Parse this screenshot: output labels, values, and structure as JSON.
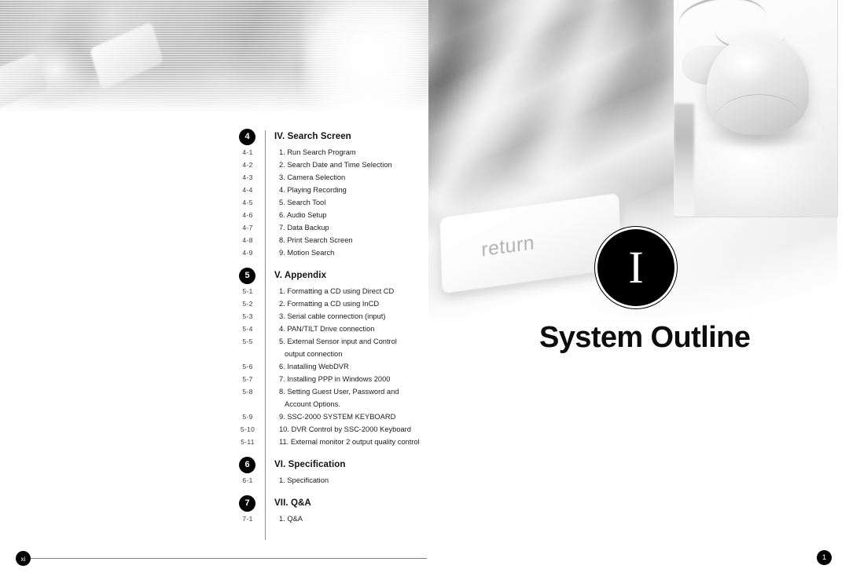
{
  "page": {
    "title": "System Outline",
    "roman_numeral": "I",
    "footer_left_page": "xi",
    "footer_right_page": "1"
  },
  "photos": [
    {
      "name": "keyboard-halftone-photo",
      "caption": ""
    },
    {
      "name": "return-key-photo",
      "caption": "return"
    },
    {
      "name": "computer-mouse-photo",
      "caption": ""
    }
  ],
  "toc": {
    "sections": [
      {
        "badge": "4",
        "title": "IV. Search Screen",
        "entries": [
          {
            "num": "4-1",
            "label": "1. Run Search Program"
          },
          {
            "num": "4-2",
            "label": "2. Search Date and Time Selection"
          },
          {
            "num": "4-3",
            "label": "3. Camera Selection"
          },
          {
            "num": "4-4",
            "label": "4. Playing Recording"
          },
          {
            "num": "4-5",
            "label": "5. Search Tool"
          },
          {
            "num": "4-6",
            "label": "6. Audio Setup"
          },
          {
            "num": "4-7",
            "label": "7. Data Backup"
          },
          {
            "num": "4-8",
            "label": "8. Print Search Screen"
          },
          {
            "num": "4-9",
            "label": "9. Motion Search"
          }
        ]
      },
      {
        "badge": "5",
        "title": "V. Appendix",
        "entries": [
          {
            "num": "5-1",
            "label": "1. Formatting a CD using Direct CD"
          },
          {
            "num": "5-2",
            "label": "2. Formatting a CD using InCD"
          },
          {
            "num": "5-3",
            "label": "3. Serial cable connection (input)"
          },
          {
            "num": "5-4",
            "label": "4. PAN/TILT Drive connection"
          },
          {
            "num": "5-5",
            "label": "5. External Sensor input and Control"
          },
          {
            "num": "",
            "label": "output connection",
            "continuation": true
          },
          {
            "num": "5-6",
            "label": "6. Inatalling WebDVR"
          },
          {
            "num": "5-7",
            "label": "7. Installing PPP in Windows 2000"
          },
          {
            "num": "5-8",
            "label": "8. Setting Guest User, Password and"
          },
          {
            "num": "",
            "label": "Account Options.",
            "continuation": true
          },
          {
            "num": "5-9",
            "label": "9. SSC-2000 SYSTEM KEYBOARD"
          },
          {
            "num": "5-10",
            "label": "10. DVR Control by SSC-2000 Keyboard"
          },
          {
            "num": "5-11",
            "label": "11. External monitor 2  output quality control"
          }
        ]
      },
      {
        "badge": "6",
        "title": "VI. Specification",
        "entries": [
          {
            "num": "6-1",
            "label": "1. Specification"
          }
        ]
      },
      {
        "badge": "7",
        "title": "VII. Q&A",
        "entries": [
          {
            "num": "7-1",
            "label": "1. Q&A"
          }
        ]
      }
    ]
  },
  "colors": {
    "ink": "#000000",
    "rule": "#808080",
    "text": "#1c1c1c",
    "entry_num": "#3b3b3b"
  }
}
